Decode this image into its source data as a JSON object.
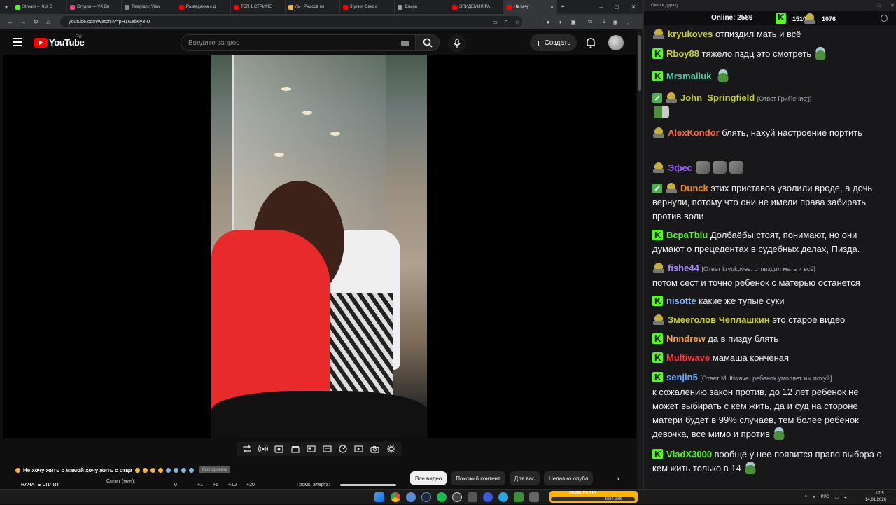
{
  "browser": {
    "tabs": [
      {
        "label": "Stream – Kick D",
        "color": "#53fc18"
      },
      {
        "label": "Студия — VK Ви",
        "color": "#e04a8a"
      },
      {
        "label": "Telegram: View",
        "color": "#888888"
      },
      {
        "label": "Разведенка с д",
        "color": "#ff0000"
      },
      {
        "label": "ТОП 1 СТРИМЕ",
        "color": "#ff0000"
      },
      {
        "label": "/b/ - Ржасов по",
        "color": "#f4b63f"
      },
      {
        "label": "Жулик. Секс и",
        "color": "#ff0000"
      },
      {
        "label": "Дзыра",
        "color": "#999999"
      },
      {
        "label": "ЭПИДЕМИЯ РА",
        "color": "#ff0000"
      },
      {
        "label": "Не хочу",
        "color": "#ff0000"
      }
    ],
    "url": "youtube.com/watch?v=pH1Gab6y3-U"
  },
  "youtube": {
    "wordmark": "YouTube",
    "region": "RU",
    "search_placeholder": "Введите запрос",
    "create_label": "Создать",
    "title": "Не хочу жить с мамой хочу жить с отца",
    "title_chip": "Скопировать",
    "bottom": {
      "start_split": "НАЧАТЬ СПЛИТ",
      "split_min": "Сплит (мин):",
      "zero": "0",
      "p1": "+1",
      "p5": "+5",
      "p10": "+10",
      "p20": "+20",
      "alert_volume": "Громк. алерта:"
    },
    "chips": [
      "Все видео",
      "Похожий контент",
      "Для вас",
      "Недавно опубл"
    ]
  },
  "chat": {
    "window_title": "Окно в дураку",
    "online_label": "Online:",
    "online_count": "2586",
    "stat_k": "1510",
    "stat_b": "1076",
    "messages": [
      {
        "user": "kryukoves",
        "color": "#c7d12a",
        "text": "отпиздил мать и всё"
      },
      {
        "user": "Rboy88",
        "color": "#c7d12a",
        "text": "тяжело пздц это смотреть"
      },
      {
        "user": "Mrsmailuk",
        "color": "#53c9a0",
        "text": ""
      },
      {
        "user": "John_Springfield",
        "color": "#c7d12a",
        "reply": "[Ответ ГриПенисӡ]",
        "text": ""
      },
      {
        "user": "AlexKondor",
        "color": "#ff6a3d",
        "text": "блять, нахуй настроение портить"
      },
      {
        "user": "Эфес",
        "color": "#9b5cff",
        "text": ""
      },
      {
        "user": "Dunck",
        "color": "#ff8a00",
        "text": "этих приставов уволили вроде, а дочь вернули, потому что они не имели права забирать против воли"
      },
      {
        "user": "BcpaTblu",
        "color": "#53fc18",
        "text": "Долбаёбы стоят, понимают, но они думают о прецедентах в судебных делах, Пизда."
      },
      {
        "user": "fishe44",
        "color": "#a78bfa",
        "reply": "[Ответ kryukoves: отпиздил мать и всё]",
        "text": "потом сест и точно ребенок с матерью останется"
      },
      {
        "user": "nisotte",
        "color": "#8ab4f8",
        "text": "какие же тупые суки"
      },
      {
        "user": "Змееголов Чеплашкин",
        "color": "#c7d12a",
        "text": "это старое видео"
      },
      {
        "user": "Nnndrew",
        "color": "#ff9d3d",
        "text": "да в пизду блять"
      },
      {
        "user": "Multiwave",
        "color": "#ff3d3d",
        "text": "мамаша конченая"
      },
      {
        "user": "senjin5",
        "color": "#6ea8ff",
        "reply": "[Ответ Multiwave: ребенок умоляет им похуй]",
        "text": "к сожалению закон против, до 12 лет ребенок не может выбирать с кем жить, да и суд на стороне матери будет в 99% случаев, тем более ребенок девочка, все мимо и против"
      },
      {
        "user": "VladX3000",
        "color": "#53fc18",
        "text": "вообще у нее появится право выбора с кем жить только в 14"
      }
    ]
  },
  "taskbar": {
    "widget_label": "MEME PARTY",
    "widget_count": "950 / 1500",
    "lang": "РУС",
    "time": "17:51",
    "date": "14.01.2026"
  }
}
